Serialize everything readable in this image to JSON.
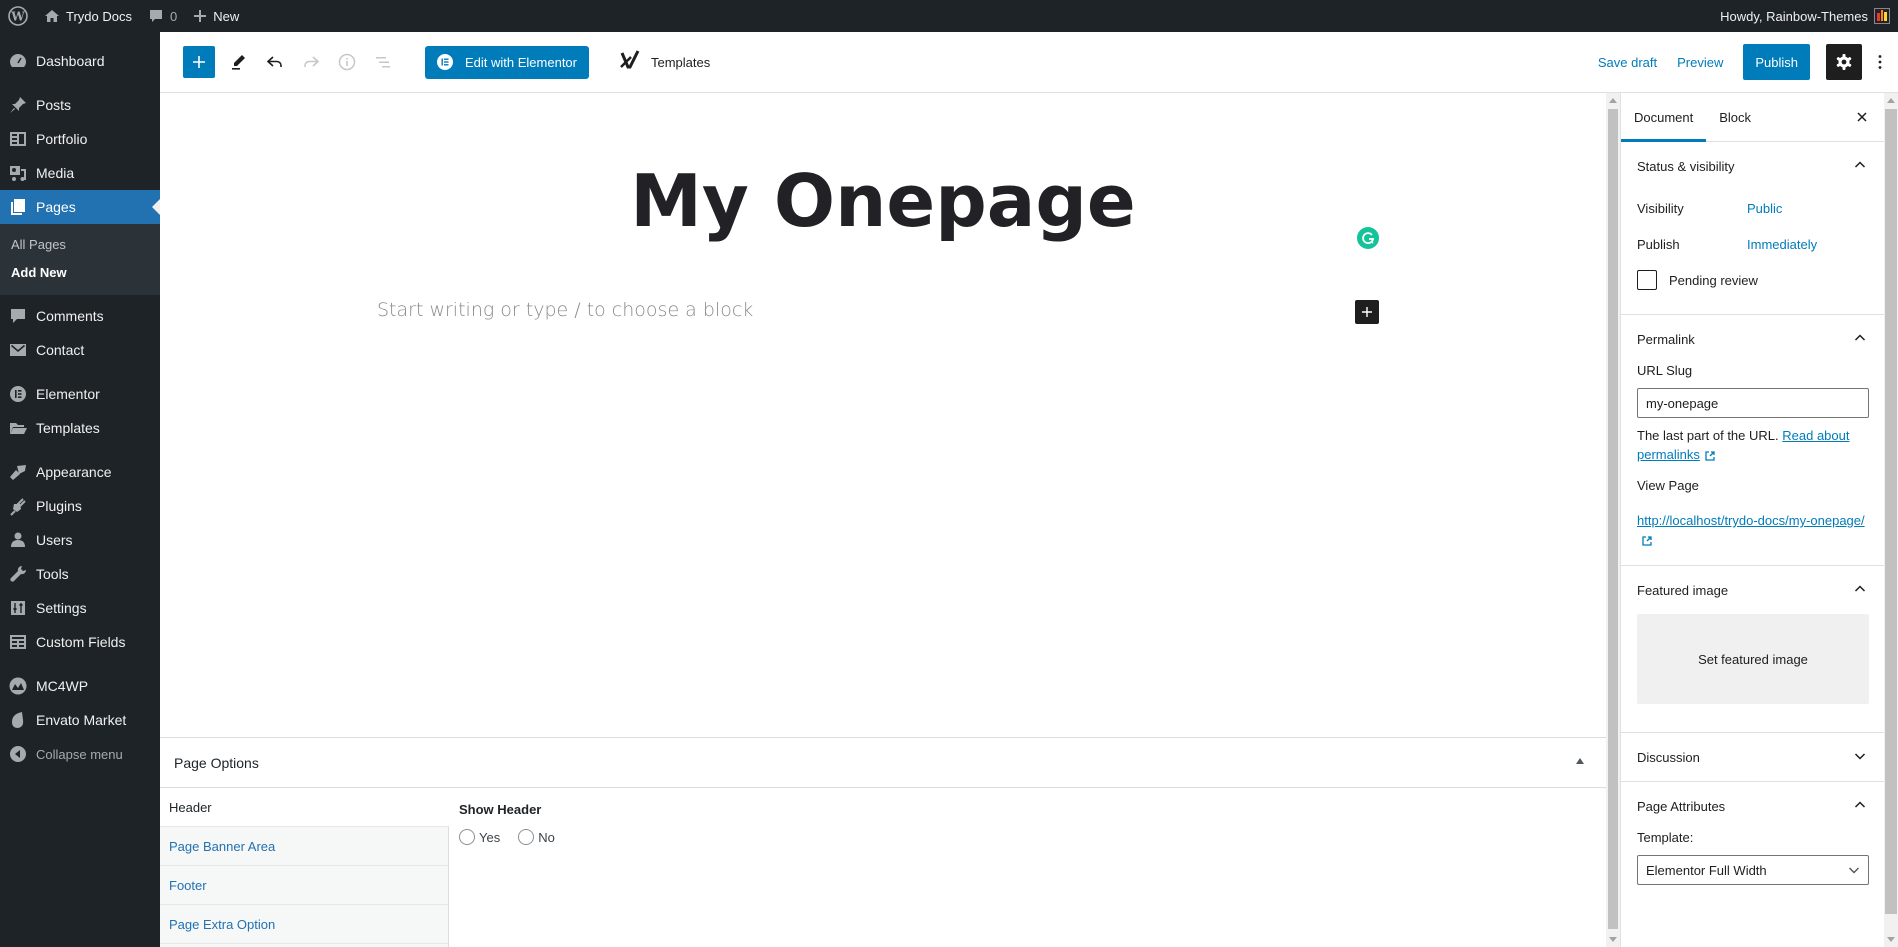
{
  "admin_bar": {
    "site_name": "Trydo Docs",
    "comments_count": "0",
    "new_label": "New",
    "greeting": "Howdy, Rainbow-Themes",
    "avatar_colors": [
      "#e53935",
      "#fb8c00",
      "#fdd835"
    ]
  },
  "sidebar": {
    "items": [
      {
        "label": "Dashboard",
        "icon": "dashboard-icon"
      },
      {
        "label": "Posts",
        "icon": "pin-icon"
      },
      {
        "label": "Portfolio",
        "icon": "portfolio-icon"
      },
      {
        "label": "Media",
        "icon": "media-icon"
      },
      {
        "label": "Pages",
        "icon": "pages-icon",
        "current": true
      },
      {
        "label": "Comments",
        "icon": "comment-icon"
      },
      {
        "label": "Contact",
        "icon": "mail-icon"
      },
      {
        "label": "Elementor",
        "icon": "elementor-icon"
      },
      {
        "label": "Templates",
        "icon": "folder-icon"
      },
      {
        "label": "Appearance",
        "icon": "brush-icon"
      },
      {
        "label": "Plugins",
        "icon": "plug-icon"
      },
      {
        "label": "Users",
        "icon": "user-icon"
      },
      {
        "label": "Tools",
        "icon": "wrench-icon"
      },
      {
        "label": "Settings",
        "icon": "sliders-icon"
      },
      {
        "label": "Custom Fields",
        "icon": "table-icon"
      },
      {
        "label": "MC4WP",
        "icon": "mc4wp-icon"
      },
      {
        "label": "Envato Market",
        "icon": "leaf-icon"
      }
    ],
    "submenu": [
      {
        "label": "All Pages"
      },
      {
        "label": "Add New",
        "current": true
      }
    ],
    "collapse_label": "Collapse menu"
  },
  "toolbar": {
    "elementor_label": "Edit with Elementor",
    "templates_label": "Templates",
    "save_draft_label": "Save draft",
    "preview_label": "Preview",
    "publish_label": "Publish"
  },
  "canvas": {
    "title": "My Onepage",
    "placeholder": "Start writing or type / to choose a block"
  },
  "metabox": {
    "title": "Page Options",
    "tabs": [
      "Header",
      "Page Banner Area",
      "Footer",
      "Page Extra Option"
    ],
    "active_tab": "Header",
    "field_label": "Show Header",
    "options": [
      "Yes",
      "No"
    ]
  },
  "settings": {
    "tabs": [
      "Document",
      "Block"
    ],
    "active_tab": "Document",
    "status": {
      "title": "Status & visibility",
      "visibility_label": "Visibility",
      "visibility_value": "Public",
      "publish_label": "Publish",
      "publish_value": "Immediately",
      "pending_label": "Pending review",
      "pending_checked": false
    },
    "permalink": {
      "title": "Permalink",
      "slug_label": "URL Slug",
      "slug_value": "my-onepage",
      "help_text": "The last part of the URL.",
      "help_link": "Read about permalinks",
      "view_label": "View Page",
      "view_url": "http://localhost/trydo-docs/my-onepage/"
    },
    "featured": {
      "title": "Featured image",
      "button": "Set featured image"
    },
    "discussion": {
      "title": "Discussion"
    },
    "attributes": {
      "title": "Page Attributes",
      "template_label": "Template:",
      "template_value": "Elementor Full Width"
    }
  }
}
